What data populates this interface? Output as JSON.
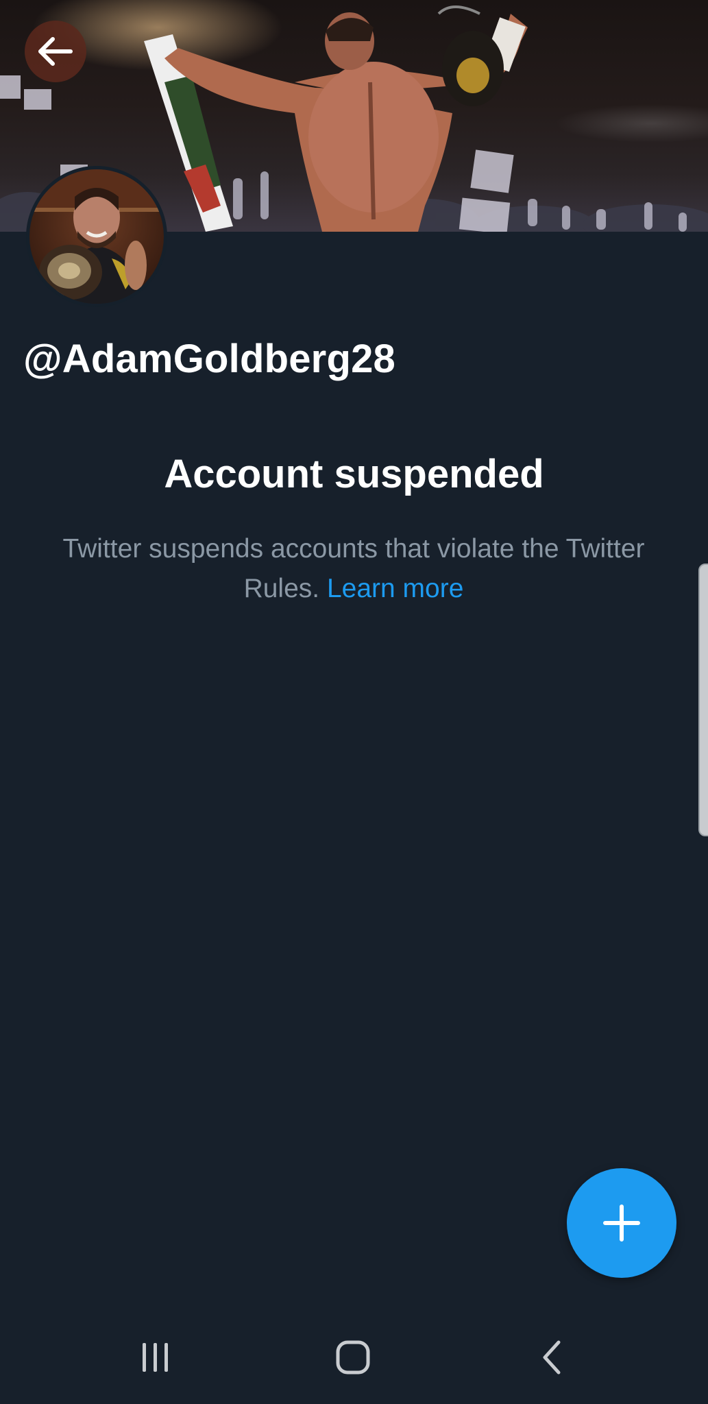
{
  "profile": {
    "handle": "@AdamGoldberg28"
  },
  "suspension": {
    "title": "Account suspended",
    "message": "Twitter suspends accounts that violate the Twitter Rules.",
    "link_label": "Learn more"
  },
  "icons": {
    "back": "arrow-left-icon",
    "compose": "plus-icon",
    "recents": "recent-apps-icon",
    "home": "home-icon",
    "nav_back": "chevron-left-icon"
  },
  "colors": {
    "background": "#17202b",
    "accent": "#1d9bf0",
    "text_primary": "#ffffff",
    "text_secondary": "#8b98a5",
    "back_button_bg": "#5a281c"
  }
}
